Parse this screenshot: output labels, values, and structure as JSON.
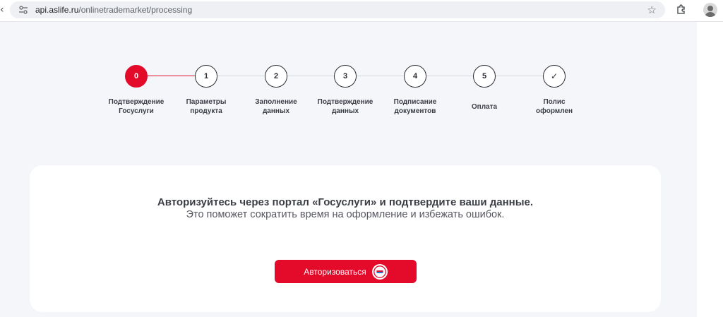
{
  "browser": {
    "url_host": "api.aslife.ru",
    "url_path": "/onlinetrademarket/processing",
    "left_edge_glyph": "⸏"
  },
  "stepper": {
    "steps": [
      {
        "number": "0",
        "label": "Подтверждение\nГосуслуги",
        "active": true
      },
      {
        "number": "1",
        "label": "Параметры\nпродукта",
        "active": false
      },
      {
        "number": "2",
        "label": "Заполнение\nданных",
        "active": false
      },
      {
        "number": "3",
        "label": "Подтверждение\nданных",
        "active": false
      },
      {
        "number": "4",
        "label": "Подписание\nдокументов",
        "active": false
      },
      {
        "number": "5",
        "label": "Оплата",
        "active": false
      },
      {
        "number": "✓",
        "label": "Полис\nоформлен",
        "active": false
      }
    ]
  },
  "card": {
    "headline": "Авторизуйтесь через портал «Госуслуги» и подтвердите ваши данные.",
    "subline": "Это поможет сократить время на оформление и избежать ошибок.",
    "auth_button_label": "Авторизоваться"
  },
  "colors": {
    "accent": "#e30a2a",
    "step_border": "#2b2d33",
    "background": "#f4f6fa"
  }
}
